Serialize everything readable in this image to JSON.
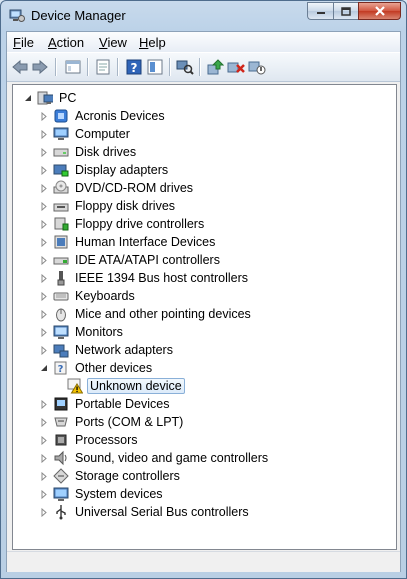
{
  "window": {
    "title": "Device Manager"
  },
  "menu": [
    {
      "label": "File",
      "accel": "F",
      "rest": "ile"
    },
    {
      "label": "Action",
      "accel": "A",
      "rest": "ction"
    },
    {
      "label": "View",
      "accel": "V",
      "rest": "iew"
    },
    {
      "label": "Help",
      "accel": "H",
      "rest": "elp"
    }
  ],
  "toolbar": {
    "buttons": [
      "back-icon",
      "forward-icon",
      "console-tree-icon",
      "properties-icon",
      "help-icon",
      "show-hide-icon",
      "scan-hardware-icon",
      "update-driver-icon",
      "uninstall-icon",
      "disable-icon"
    ]
  },
  "tree": {
    "root": "PC",
    "categories": [
      {
        "label": "Acronis Devices",
        "icon": "device-icon",
        "expanded": false
      },
      {
        "label": "Computer",
        "icon": "computer-icon",
        "expanded": false
      },
      {
        "label": "Disk drives",
        "icon": "disk-drive-icon",
        "expanded": false
      },
      {
        "label": "Display adapters",
        "icon": "display-adapter-icon",
        "expanded": false
      },
      {
        "label": "DVD/CD-ROM drives",
        "icon": "dvd-icon",
        "expanded": false
      },
      {
        "label": "Floppy disk drives",
        "icon": "floppy-icon",
        "expanded": false
      },
      {
        "label": "Floppy drive controllers",
        "icon": "floppy-controller-icon",
        "expanded": false
      },
      {
        "label": "Human Interface Devices",
        "icon": "hid-icon",
        "expanded": false
      },
      {
        "label": "IDE ATA/ATAPI controllers",
        "icon": "ide-icon",
        "expanded": false
      },
      {
        "label": "IEEE 1394 Bus host controllers",
        "icon": "ieee1394-icon",
        "expanded": false
      },
      {
        "label": "Keyboards",
        "icon": "keyboard-icon",
        "expanded": false
      },
      {
        "label": "Mice and other pointing devices",
        "icon": "mouse-icon",
        "expanded": false
      },
      {
        "label": "Monitors",
        "icon": "monitor-icon",
        "expanded": false
      },
      {
        "label": "Network adapters",
        "icon": "network-icon",
        "expanded": false
      },
      {
        "label": "Other devices",
        "icon": "other-devices-icon",
        "expanded": true,
        "children": [
          {
            "label": "Unknown device",
            "icon": "unknown-device-warning-icon",
            "selected": true
          }
        ]
      },
      {
        "label": "Portable Devices",
        "icon": "portable-icon",
        "expanded": false
      },
      {
        "label": "Ports (COM & LPT)",
        "icon": "ports-icon",
        "expanded": false
      },
      {
        "label": "Processors",
        "icon": "processor-icon",
        "expanded": false
      },
      {
        "label": "Sound, video and game controllers",
        "icon": "sound-icon",
        "expanded": false
      },
      {
        "label": "Storage controllers",
        "icon": "storage-icon",
        "expanded": false
      },
      {
        "label": "System devices",
        "icon": "system-icon",
        "expanded": false
      },
      {
        "label": "Universal Serial Bus controllers",
        "icon": "usb-icon",
        "expanded": false
      }
    ]
  },
  "colors": {
    "accent": "#3a6ea5",
    "warning": "#f5c400",
    "selection": "#dcebfa"
  }
}
